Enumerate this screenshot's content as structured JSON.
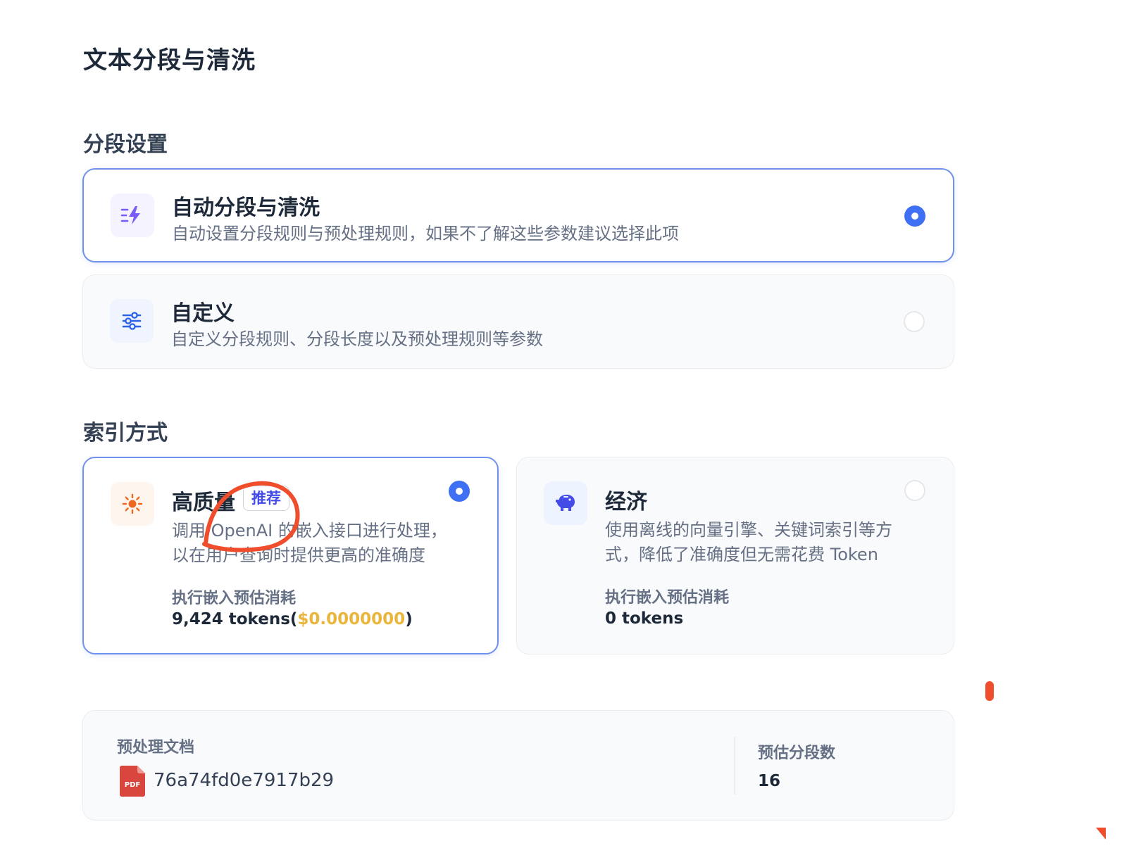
{
  "page": {
    "title": "文本分段与清洗"
  },
  "segmentation": {
    "section_title": "分段设置",
    "options": [
      {
        "title": "自动分段与清洗",
        "description": "自动设置分段规则与预处理规则，如果不了解这些参数建议选择此项",
        "icon": "lightning-icon",
        "selected": true
      },
      {
        "title": "自定义",
        "description": "自定义分段规则、分段长度以及预处理规则等参数",
        "icon": "sliders-icon",
        "selected": false
      }
    ]
  },
  "indexing": {
    "section_title": "索引方式",
    "options": [
      {
        "title": "高质量",
        "badge": "推荐",
        "description_line1": "调用 OpenAI 的嵌入接口进行处理，",
        "description_line2": "以在用户查询时提供更高的准确度",
        "estimate_label": "执行嵌入预估消耗",
        "tokens": "9,424 tokens(",
        "price": "$0.0000000",
        "price_suffix": ")",
        "icon": "sun-icon",
        "selected": true
      },
      {
        "title": "经济",
        "description_line1": "使用离线的向量引擎、关键词索引等方",
        "description_line2": "式，降低了准确度但无需花费 Token",
        "estimate_label": "执行嵌入预估消耗",
        "tokens": "0 tokens",
        "icon": "piggy-bank-icon",
        "selected": false
      }
    ]
  },
  "preview": {
    "doc_label": "预处理文档",
    "file_icon_text": "PDF",
    "file_name": "76a74fd0e7917b29",
    "segments_label": "预估分段数",
    "segments_value": "16"
  },
  "colors": {
    "accent": "#3f6ff2",
    "selected_border": "#7090ee",
    "price": "#e9b53c",
    "badge_text": "#444ce7",
    "annotation_red": "#f04d2d",
    "pdf_red": "#d9463e"
  }
}
